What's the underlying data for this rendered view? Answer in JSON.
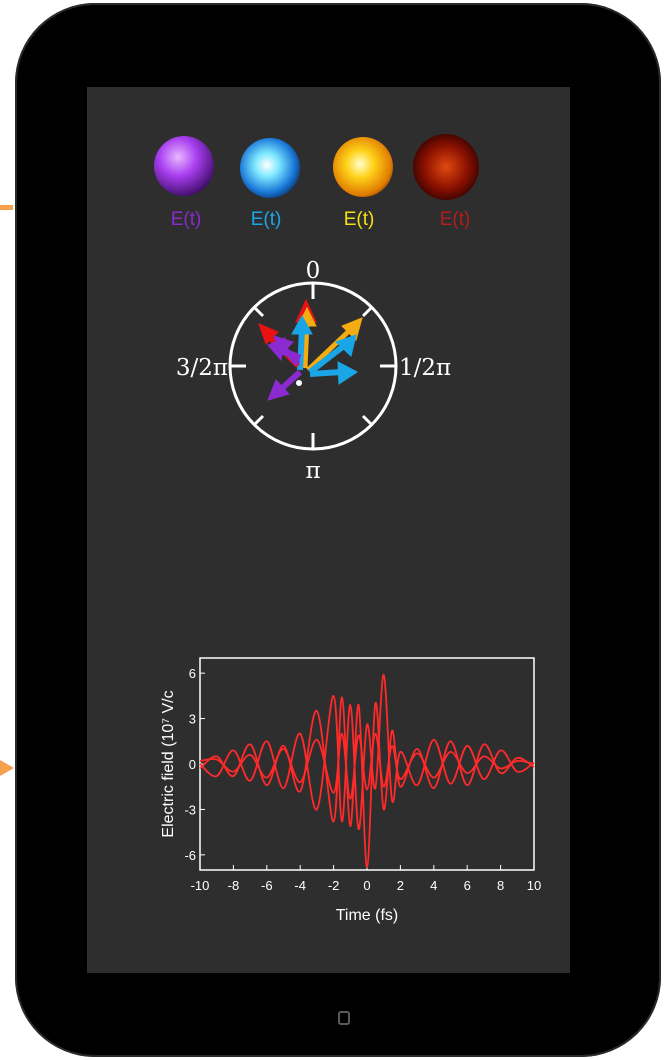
{
  "pulses": [
    {
      "label": "E(t)",
      "color": "#8a2ad0"
    },
    {
      "label": "E(t)",
      "color": "#1aa6e6"
    },
    {
      "label": "E(t)",
      "color": "#f2e018"
    },
    {
      "label": "E(t)",
      "color": "#b71c1c"
    }
  ],
  "phase_dial": {
    "top": "0",
    "right": "1/2π",
    "bottom": "π",
    "left": "3/2π"
  },
  "colors": {
    "trace": "#ff2a2a",
    "purple": "#8a2ad0",
    "blue": "#1aa6e6",
    "orange": "#f5ac12",
    "red": "#e81212",
    "accent_arrow": "#f5a04a"
  },
  "chart_data": {
    "type": "line",
    "title": "",
    "xlabel": "Time (fs)",
    "ylabel": "Electric field (10⁷ V/c",
    "xlim": [
      -10,
      10
    ],
    "ylim": [
      -7,
      7
    ],
    "x_ticks": [
      "-10",
      "-8",
      "-6",
      "-4",
      "-2",
      "0",
      "2",
      "4",
      "6",
      "8",
      "10"
    ],
    "y_ticks": [
      "6",
      "3",
      "0",
      "-3",
      "-6"
    ],
    "grid": false,
    "series": [
      {
        "x": [
          -10,
          -9,
          -8,
          -7,
          -6,
          -5,
          -4,
          -3,
          -2,
          -1.5,
          -1,
          -0.5,
          0,
          0.5,
          1,
          1.5,
          2,
          3,
          4,
          5,
          6,
          7,
          8,
          9,
          10
        ],
        "y": [
          -0.3,
          0.5,
          -0.8,
          1.3,
          -1.4,
          1.2,
          -1.8,
          3.5,
          -3.8,
          4.4,
          -4.1,
          3.9,
          -6.8,
          4.0,
          -3.0,
          2.2,
          -1.5,
          1.0,
          -1.6,
          1.5,
          -1.4,
          1.3,
          -0.6,
          0.4,
          -0.2
        ]
      },
      {
        "x": [
          -10,
          -9,
          -8,
          -7,
          -6,
          -5,
          -4,
          -3,
          -2,
          -1.5,
          -1,
          -0.5,
          0,
          0.5,
          1,
          1.5,
          2,
          3,
          4,
          5,
          6,
          7,
          8,
          9,
          10
        ],
        "y": [
          0.0,
          -0.8,
          0.9,
          -1.1,
          1.5,
          -1.6,
          2.0,
          -3.0,
          4.5,
          -3.8,
          3.9,
          -4.3,
          2.6,
          -1.6,
          5.9,
          -2.4,
          0.8,
          -1.4,
          1.6,
          -1.3,
          1.2,
          -1.0,
          0.9,
          -0.5,
          0.1
        ]
      },
      {
        "x": [
          -10,
          -9,
          -8,
          -7,
          -6,
          -5,
          -4,
          -3,
          -2,
          -1.5,
          -1,
          -0.5,
          0,
          0.5,
          1,
          1.5,
          2,
          3,
          4,
          5,
          6,
          7,
          8,
          9,
          10
        ],
        "y": [
          0.2,
          0.3,
          -0.5,
          0.6,
          -0.9,
          1.0,
          -1.2,
          1.6,
          -1.9,
          2.0,
          -2.3,
          1.9,
          -1.7,
          2.0,
          -1.5,
          1.2,
          -1.0,
          0.7,
          -0.9,
          0.8,
          -0.6,
          0.5,
          -0.3,
          0.2,
          0.0
        ]
      }
    ]
  }
}
